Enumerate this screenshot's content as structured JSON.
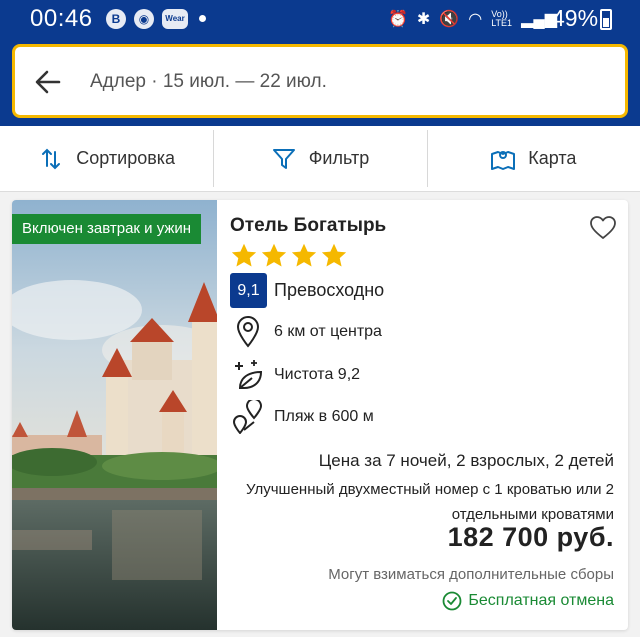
{
  "status_bar": {
    "time": "00:46",
    "icons": [
      "b-icon",
      "shield-icon",
      "wear-icon",
      "dot-icon",
      "alarm-icon",
      "bluetooth-icon",
      "mute-icon",
      "wifi-icon",
      "volte-icon",
      "signal-icon"
    ],
    "wear_label": "Wear",
    "volte_label": "Vo))\nLTE1",
    "battery": "49%"
  },
  "search": {
    "query": "Адлер · 15 июл. — 22 июл."
  },
  "toolbar": {
    "sort_label": "Сортировка",
    "filter_label": "Фильтр",
    "map_label": "Карта"
  },
  "hotel": {
    "badge": "Включен завтрак и ужин",
    "name": "Отель Богатырь",
    "stars": 4,
    "score": "9,1",
    "score_label": "Превосходно",
    "distance": "6 км от центра",
    "cleanliness": "Чистота 9,2",
    "beach": "Пляж в 600 м",
    "price_head": "Цена за 7 ночей, 2 взрослых, 2 детей",
    "room": "Улучшенный двухместный номер с 1 кроватью или 2 отдельными кроватями",
    "price": "182 700 руб.",
    "fees": "Могут взиматься дополнительные сборы",
    "cancel": "Бесплатная отмена"
  },
  "colors": {
    "header": "#0b3a8f",
    "search_border": "#f5b800",
    "star": "#f5b800",
    "green": "#1a8a34"
  }
}
